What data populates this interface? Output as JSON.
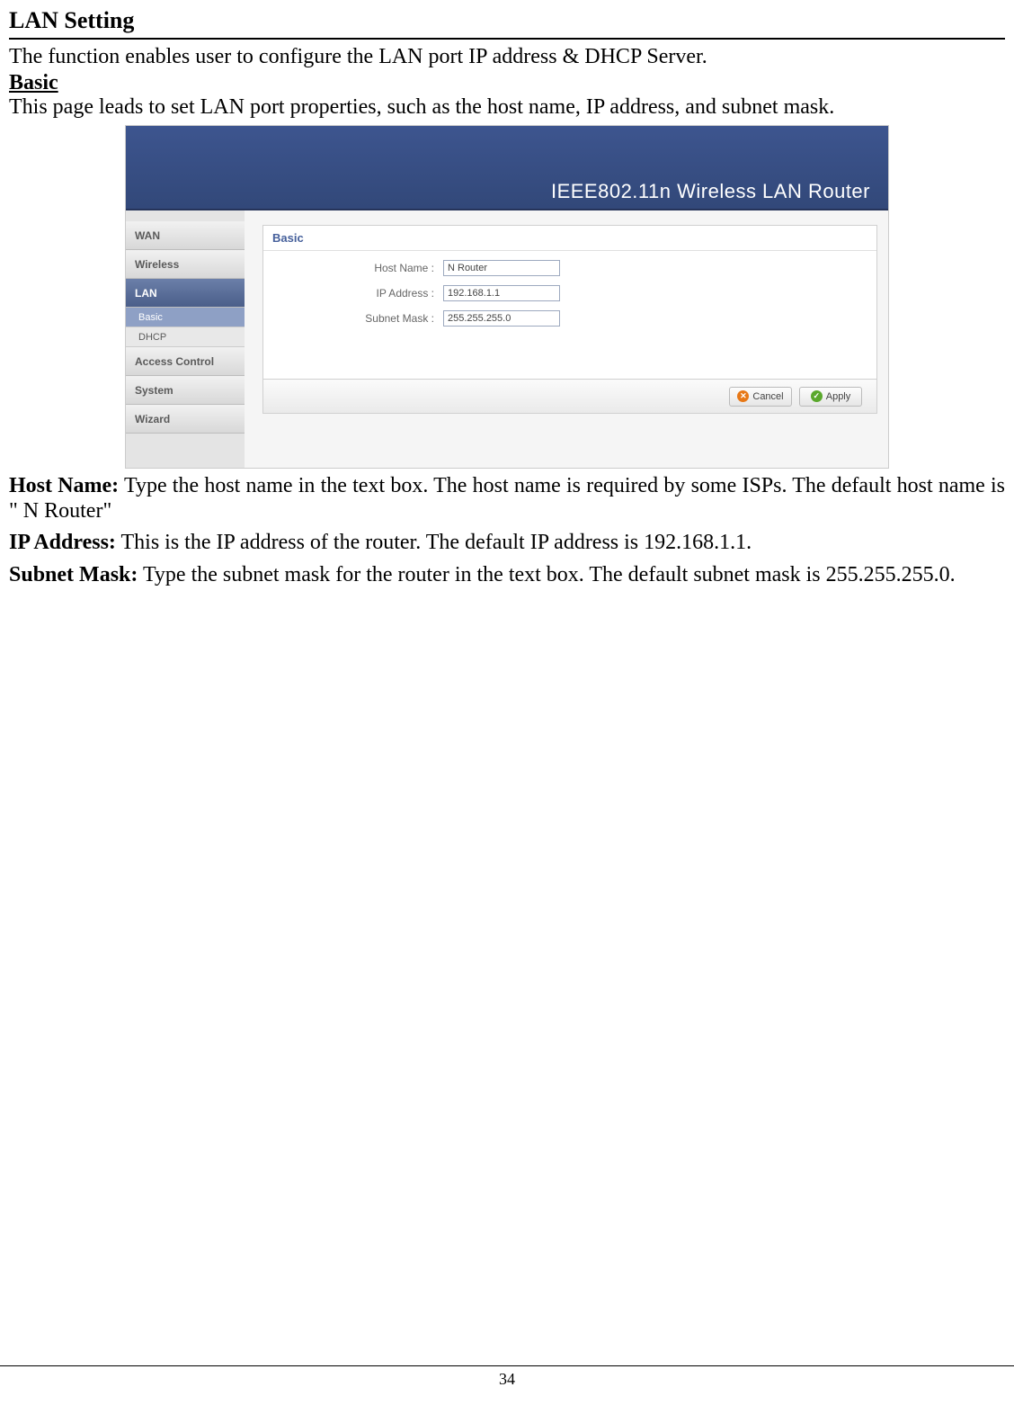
{
  "page": {
    "title": "LAN Setting",
    "intro": "The function enables user to configure the LAN port IP address & DHCP Server.",
    "sub_heading": "Basic",
    "sub_desc": "This page leads to set LAN port properties, such as the host name, IP address, and subnet mask.",
    "number": "34"
  },
  "router_ui": {
    "banner": "IEEE802.11n  Wireless LAN Router",
    "sidebar": {
      "items": [
        {
          "label": "WAN",
          "active": false
        },
        {
          "label": "Wireless",
          "active": false
        },
        {
          "label": "LAN",
          "active": true,
          "subitems": [
            {
              "label": "Basic",
              "active": true
            },
            {
              "label": "DHCP",
              "active": false
            }
          ]
        },
        {
          "label": "Access Control",
          "active": false
        },
        {
          "label": "System",
          "active": false
        },
        {
          "label": "Wizard",
          "active": false
        }
      ]
    },
    "panel": {
      "title": "Basic",
      "fields": [
        {
          "label": "Host Name :",
          "value": "N Router"
        },
        {
          "label": "IP Address :",
          "value": "192.168.1.1"
        },
        {
          "label": "Subnet Mask :",
          "value": "255.255.255.0"
        }
      ],
      "buttons": {
        "cancel": "Cancel",
        "apply": "Apply"
      }
    }
  },
  "defs": {
    "host_name": {
      "label": "Host Name:",
      "text": " Type the host name in the text box. The host name is required by some ISPs. The default host name is \" N Router\""
    },
    "ip_address": {
      "label": "IP Address:",
      "text": " This is the IP address of the router. The default IP address is 192.168.1.1."
    },
    "subnet_mask": {
      "label": "Subnet Mask:",
      "text": " Type the subnet mask for the router in the text box. The default subnet mask is 255.255.255.0."
    }
  }
}
